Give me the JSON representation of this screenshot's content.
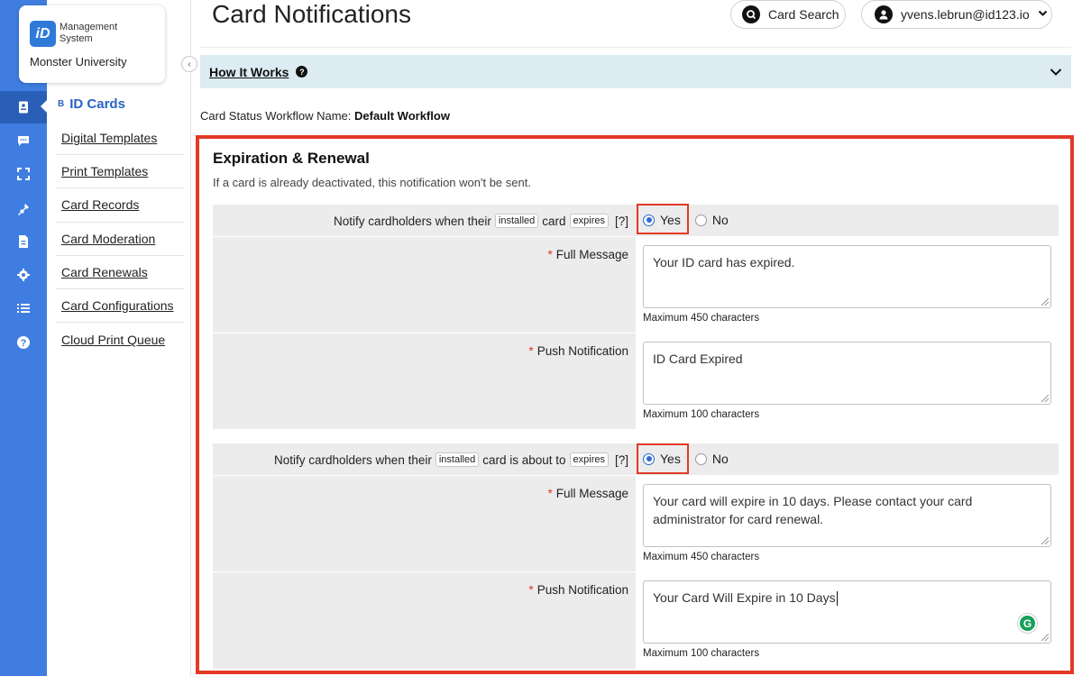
{
  "brand": {
    "logo_text": "iD",
    "system_name": "Management System",
    "org_name": "Monster University"
  },
  "rail": {
    "icons": [
      "id-card-icon",
      "chat-icon",
      "scan-icon",
      "plug-icon",
      "document-icon",
      "gear-icon",
      "list-icon",
      "help-icon"
    ]
  },
  "nav": {
    "section_icon": "B",
    "section_label": "ID Cards",
    "items": [
      {
        "label": "Digital Templates"
      },
      {
        "label": "Print Templates"
      },
      {
        "label": "Card Records"
      },
      {
        "label": "Card Moderation"
      },
      {
        "label": "Card Renewals"
      },
      {
        "label": "Card Configurations"
      },
      {
        "label": "Cloud Print Queue"
      }
    ]
  },
  "header": {
    "title": "Card Notifications",
    "card_search_label": "Card Search",
    "user_label": "yvens.lebrun@id123.io"
  },
  "how_it_works": {
    "label": "How It Works",
    "help_glyph": "?"
  },
  "workflow": {
    "prefix": "Card Status Workflow Name:",
    "name": "Default Workflow"
  },
  "section": {
    "title": "Expiration & Renewal",
    "subtitle": "If a card is already deactivated, this notification won't be sent.",
    "blocks": [
      {
        "question_pre": "Notify cardholders when their",
        "chip1": "installed",
        "question_mid": "card",
        "chip2": "expires",
        "help": "[?]",
        "yes_label": "Yes",
        "no_label": "No",
        "selected": "Yes",
        "full_message_label": "Full Message",
        "full_message_value": "Your ID card has expired.",
        "full_message_hint": "Maximum 450 characters",
        "push_label": "Push Notification",
        "push_value": "ID Card Expired",
        "push_hint": "Maximum 100 characters"
      },
      {
        "question_pre": "Notify cardholders when their",
        "chip1": "installed",
        "question_mid": "card is about to",
        "chip2": "expires",
        "help": "[?]",
        "yes_label": "Yes",
        "no_label": "No",
        "selected": "Yes",
        "full_message_label": "Full Message",
        "full_message_value": "Your card will expire in 10 days. Please contact your card administrator for card renewal.",
        "full_message_hint": "Maximum 450 characters",
        "push_label": "Push Notification",
        "push_value": "Your Card Will Expire in 10 Days",
        "push_hint": "Maximum 100 characters"
      }
    ]
  },
  "required_mark": "*",
  "grammarly_glyph": "G",
  "colors": {
    "rail": "#3f7de0",
    "accent": "#2a63c6",
    "highlight": "#e23a26",
    "how_it_works_bg": "#dcecf2"
  }
}
